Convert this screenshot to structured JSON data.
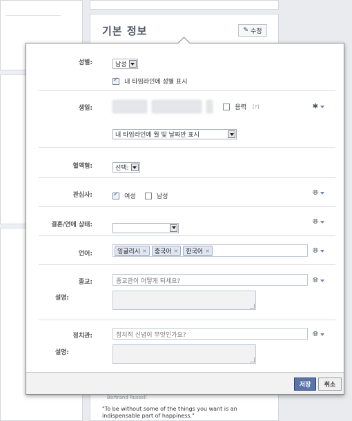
{
  "background": {
    "section_title": "기본 정보",
    "edit_button": "수정",
    "quote_author": "Bertrand Russell",
    "quote": "\"To be without some of the things you want is an indispensable part of happiness.\""
  },
  "dialog": {
    "gender": {
      "label": "성별:",
      "value": "남성",
      "show_on_timeline": "내 타임라인에 성별 표시"
    },
    "birthday": {
      "label": "생일:",
      "lunar_label": "음력",
      "lunar_help": "[?]",
      "visibility_value": "내 타임라인에 월 및 날짜만 표시"
    },
    "blood_type": {
      "label": "혈액형:",
      "value": "선택:"
    },
    "interested_in": {
      "label": "관심사:",
      "female": "여성",
      "male": "남성"
    },
    "relationship": {
      "label": "결혼/연애 상태:",
      "value": ""
    },
    "languages": {
      "label": "언어:",
      "tokens": [
        "잉글리시",
        "중국어",
        "한국어"
      ],
      "remove_glyph": "×"
    },
    "religion": {
      "label": "종교:",
      "placeholder": "종교관이 어떻게 되세요?",
      "desc_label": "설명:"
    },
    "politics": {
      "label": "정치관:",
      "placeholder": "정치적 신념이 무엇인가요?",
      "desc_label": "설명:"
    },
    "footer": {
      "save": "저장",
      "cancel": "취소"
    }
  },
  "icons": {
    "gear": "gear-icon",
    "globe": "globe-icon",
    "pencil": "pencil-icon"
  }
}
